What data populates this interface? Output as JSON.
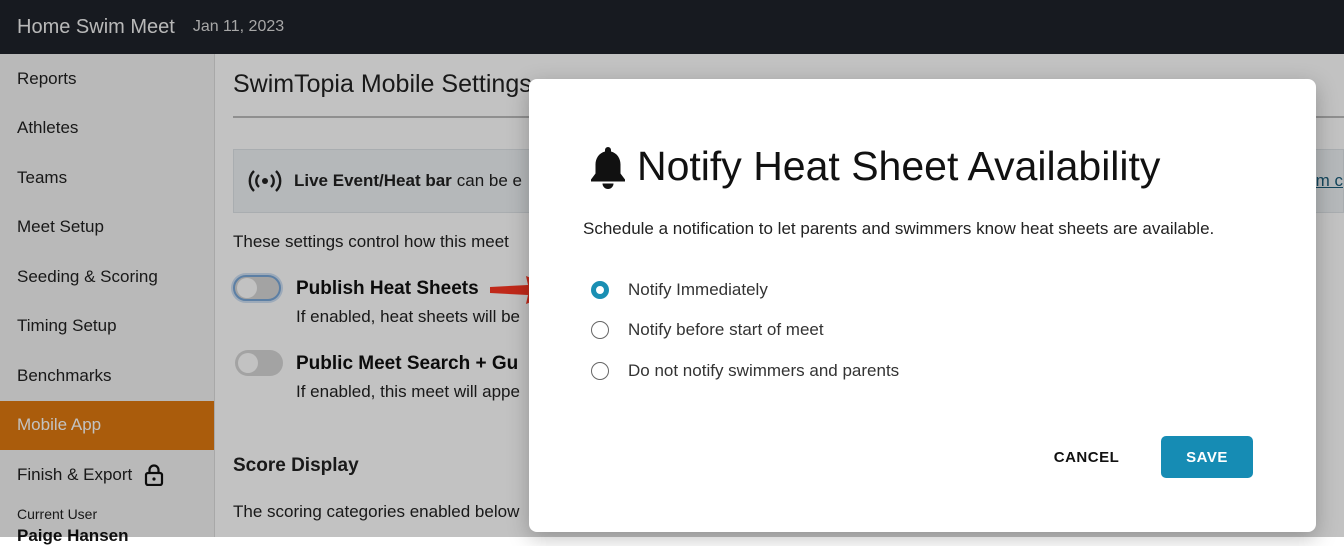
{
  "topbar": {
    "title": "Home Swim Meet",
    "date": "Jan 11, 2023"
  },
  "sidebar": {
    "items": [
      {
        "label": "Reports"
      },
      {
        "label": "Athletes"
      },
      {
        "label": "Teams"
      },
      {
        "label": "Meet Setup"
      },
      {
        "label": "Seeding & Scoring"
      },
      {
        "label": "Timing Setup"
      },
      {
        "label": "Benchmarks"
      },
      {
        "label": "Mobile App",
        "active": true
      },
      {
        "label": "Finish & Export",
        "icon": "lock-icon"
      }
    ],
    "current_user_label": "Current User",
    "current_user_name": "Paige Hansen"
  },
  "main": {
    "title": "SwimTopia Mobile Settings",
    "infobar": {
      "strong": "Live Event/Heat bar",
      "text": "can be e",
      "link_text": "m c"
    },
    "description": "These settings control how this meet",
    "settings": [
      {
        "title": "Publish Heat Sheets",
        "subtitle": "If enabled, heat sheets will be"
      },
      {
        "title": "Public Meet Search + Gu",
        "subtitle": "If enabled, this meet will appe"
      }
    ],
    "score_display": {
      "title": "Score Display",
      "description": "The scoring categories enabled below"
    }
  },
  "modal": {
    "title": "Notify Heat Sheet Availability",
    "description": "Schedule a notification to let parents and swimmers know heat sheets are available.",
    "options": [
      {
        "label": "Notify Immediately",
        "checked": true
      },
      {
        "label": "Notify before start of meet",
        "checked": false
      },
      {
        "label": "Do not notify swimmers and parents",
        "checked": false
      }
    ],
    "cancel_label": "CANCEL",
    "save_label": "SAVE"
  },
  "colors": {
    "topbar_bg": "#1f232b",
    "active_nav": "#e07a10",
    "accent": "#168cb4",
    "arrow": "#c0291a"
  }
}
